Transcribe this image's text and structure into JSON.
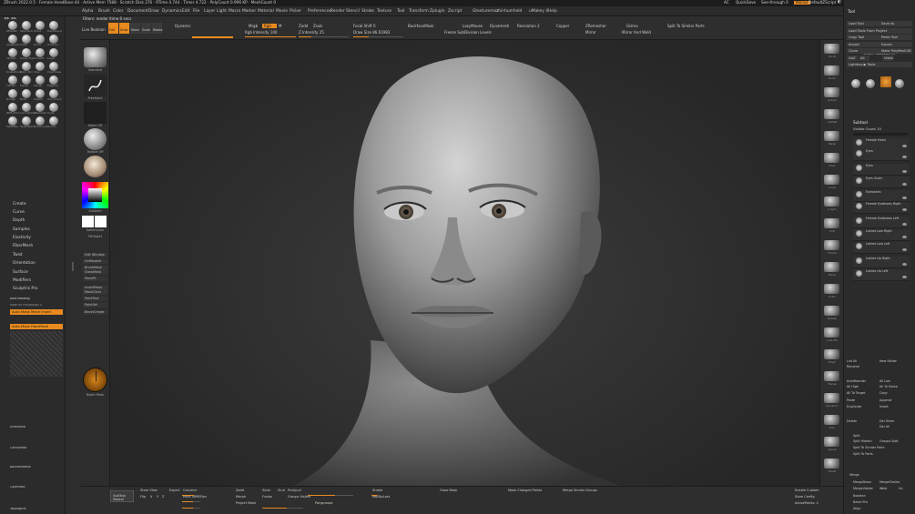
{
  "app": {
    "title": "ZBrush 2022.0.5 · Female HeadBase 44 · Active Mem 7588 · Scratch Disk 276 · RTime 4.744 · Timer 4.722 · PolyCount 0.996 KP · MeshCount 0",
    "right": [
      "AC",
      "QuickSave",
      "See-through  0",
      "Menus",
      "DefaultZScript"
    ]
  },
  "menu": [
    "Alpha",
    "Brush",
    "Color",
    "Document",
    "Draw",
    "Dynamics",
    "Edit",
    "File",
    "Layer",
    "Light",
    "Macro",
    "Marker",
    "Material",
    "Movie",
    "Picker",
    "Preferences",
    "Render",
    "Stencil",
    "Stroke",
    "Texture",
    "Tool",
    "Transform",
    "Zplugin",
    "Zscript",
    "Gtexturemoz",
    "zhinhumhold",
    "uMakey 4",
    "Help"
  ],
  "brushes": [
    "ZModelr",
    "Standard",
    "Move",
    "DamStand",
    "ClayBuild",
    "Inflat",
    "Pinch",
    "TrimDyn",
    "hPolish",
    "Move_Top",
    "Smooth",
    "Layer",
    "SnakeHook",
    "Dam_Std",
    "Clay",
    "ClayTubes",
    "Flatten",
    "Planar",
    "Morph",
    "Magnify",
    "Nudge",
    "Blob",
    "Slash3",
    "Orb_Crack",
    "IMM_Prim",
    "CurveTube",
    "ZRemesh",
    "Knife",
    "MaskPen",
    "SelectRect",
    "TrimCurve",
    "Gizmo"
  ],
  "left_menus": [
    "Create",
    "Curve",
    "Depth",
    "Samples",
    "Elasticity",
    "FiberMesh",
    "Twist",
    "Orientation",
    "Surface",
    "Modifiers",
    "Sculptris Pro"
  ],
  "auto_mask": {
    "title": "Auto Masking",
    "mask_by_polygroups": "Mask By Polygroups 0",
    "mesh_insert": "Auto Mask Mesh Insert",
    "fiber": "Auto Mask FiberMesh"
  },
  "left_lower": [
    "Directional",
    "CavityMask",
    "BackfaceMask",
    "ColorMask",
    "Topological"
  ],
  "shelf": {
    "brush": "Standard",
    "stroke": "FreeHand",
    "alpha": "Alpha Off",
    "texture": "Texture Off",
    "material": "MatCap Gray",
    "gradient": "Gradient",
    "switch": "SwitchColor",
    "fill": "FillObject",
    "btns": [
      "Edit Window",
      "UnMasked",
      "BrushMask",
      "GrowMask",
      "MaskPL",
      "InvertMask",
      "MaskClear",
      "PaintTool",
      "PaintSel",
      "BevelCreate"
    ],
    "depth": "Depth Mask"
  },
  "top": {
    "filters": "Filters: render ltime:0 secs",
    "lines": [
      "Live Boolean",
      "Mrgb",
      "Rgb",
      "M",
      "Zadd",
      "Zsub",
      "Zcut",
      "Focal Shift 0",
      "BackfaceMask",
      "LazyMouse",
      "Dynamesh",
      "Resolution 2",
      "Creased",
      "Polish",
      "SubD"
    ],
    "zint": "Z Intensity 25",
    "rgb": "Rgb Intensity 100",
    "draw": "Draw Size 86.61983",
    "dyn": "Dynamic",
    "gizmo": "Gizmo",
    "zremesh": "ZRemesher",
    "split": "Split To Similar Parts",
    "edit": "Edit",
    "move": "Move",
    "scale": "Scale",
    "rotate": "Rotate",
    "spotl": "Spotlight",
    "mirror": "Mirror",
    "freeze": "Freeze SubDivision Levels",
    "hist": "History",
    "weld": "Mirror And Weld"
  },
  "right_shelf": [
    "Scroll",
    "Zoom",
    "Actual",
    "AAHalf",
    "Persp",
    "Floor",
    "Local",
    "L.Sym",
    "XYZ",
    "Frame",
    "Move",
    "Scale",
    "Rotate",
    "Line Fill",
    "PolyF",
    "Transp",
    "Dynamic",
    "Solo",
    "Xpose",
    "Ghost"
  ],
  "tool": {
    "title": "Tool",
    "btns": [
      "Load Tool",
      "Save As",
      "Load Tools From Project",
      "Copy Tool",
      "Paste Tool",
      "Import",
      "Export",
      "Clone",
      "Make PolyMesh3D",
      "GoZ",
      "All",
      "Visible",
      "Lightbox ▶ Tools"
    ],
    "current": "Female HeadBase 44",
    "subtool": "Subtool",
    "visible": "Visible Count 10",
    "items": [
      "Female Head",
      "Eyes",
      "Eyes",
      "Eyes Outer",
      "Eyelashes",
      "Female Eyebrows Right",
      "Female Eyebrows Left",
      "Lashes Low Right",
      "Lashes Low Left",
      "Lashes Up Right",
      "Lashes Up Left"
    ],
    "lower": [
      "List All",
      "New Folder",
      "Rename",
      "AutoReorder",
      "All Low",
      "All High",
      "All To Home",
      "All To Target",
      "Copy",
      "Paste",
      "Append",
      "Duplicate",
      "Insert",
      "Delete",
      "Del Other",
      "Del All",
      "Split",
      "Split Hidden",
      "Groups Split",
      "Split To Similar Parts",
      "Split To Parts",
      "Merge",
      "MergeDown",
      "MergeSimilar",
      "MergeVisible",
      "Weld",
      "Uv",
      "Boolean",
      "Bevel Pro",
      "Align"
    ]
  },
  "bottom": {
    "title": "SubTool Master",
    "cols": [
      "Store View",
      "Expert",
      "Columns",
      "Flip",
      "X",
      "Y",
      "Z",
      "Point Selection",
      "Zadd",
      "Zsub",
      "Zcut",
      "Morph",
      "Fusion",
      "Stroke",
      "ReplayLast",
      "Project Mask",
      "Pushpull",
      "Groups Visible",
      "Mask Changed Points",
      "Merge Similar Groups",
      "Polygroupit",
      "Grow Mask",
      "Enable Custom",
      "Store Config",
      "ActivePoints: 2"
    ]
  },
  "colors": {
    "accent": "#e88a1f",
    "bg": "#2a2a2a",
    "panel": "#2b2b2b"
  }
}
